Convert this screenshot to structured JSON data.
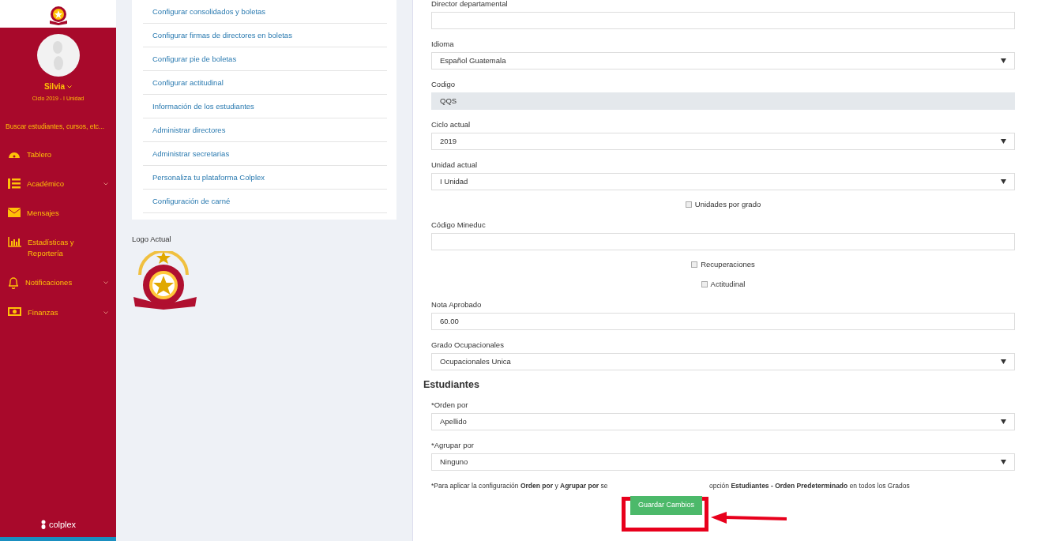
{
  "sidebar": {
    "user": {
      "name": "Silvia",
      "subtitle": "Ciclo 2019 - I Unidad"
    },
    "search": {
      "placeholder": "Buscar estudiantes, cursos, etc..."
    },
    "items": [
      {
        "label": "Tablero",
        "expandable": false
      },
      {
        "label": "Académico",
        "expandable": true
      },
      {
        "label": "Mensajes",
        "expandable": false
      },
      {
        "label": "Estadísticas y Reportería",
        "expandable": false
      },
      {
        "label": "Notificaciones",
        "expandable": true
      },
      {
        "label": "Finanzas",
        "expandable": true
      }
    ],
    "footer": "colplex"
  },
  "settings_links": [
    "Configurar consolidados y boletas",
    "Configurar firmas de directores en boletas",
    "Configurar pie de boletas",
    "Configurar actitudinal",
    "Información de los estudiantes",
    "Administrar directores",
    "Administrar secretarias",
    "Personaliza tu plataforma Colplex",
    "Configuración de carné"
  ],
  "logo_label": "Logo Actual",
  "form": {
    "fields": [
      {
        "kind": "text",
        "label": "Director departamental"
      },
      {
        "kind": "select",
        "label": "Idioma",
        "value": "Español Guatemala"
      },
      {
        "kind": "readonly",
        "label": "Codigo",
        "value": "QQS"
      },
      {
        "kind": "select",
        "label": "Ciclo actual",
        "value": "2019"
      },
      {
        "kind": "select",
        "label": "Unidad actual",
        "value": "I Unidad"
      },
      {
        "kind": "checkbox",
        "label": "Unidades por grado",
        "checked": false
      },
      {
        "kind": "text",
        "label": "Código Mineduc"
      },
      {
        "kind": "checkbox",
        "label": "Recuperaciones",
        "checked": false
      },
      {
        "kind": "checkbox",
        "label": "Actitudinal",
        "checked": false
      },
      {
        "kind": "text",
        "label": "Nota Aprobado",
        "value": "60.00"
      },
      {
        "kind": "select",
        "label": "Grado Ocupacionales",
        "value": "Ocupacionales Unica"
      },
      {
        "kind": "heading",
        "label": "Estudiantes"
      },
      {
        "kind": "select",
        "label": "*Orden por",
        "value": "Apellido"
      },
      {
        "kind": "select",
        "label": "*Agrupar por",
        "value": "Ninguno"
      }
    ],
    "note_start": "*Para aplicar la configuración **Orden por** y **Agrupar por** se",
    "note_end": "opción **Estudiantes - Orden Predeterminado** en todos los Grados",
    "save_button": "Guardar Cambios"
  }
}
